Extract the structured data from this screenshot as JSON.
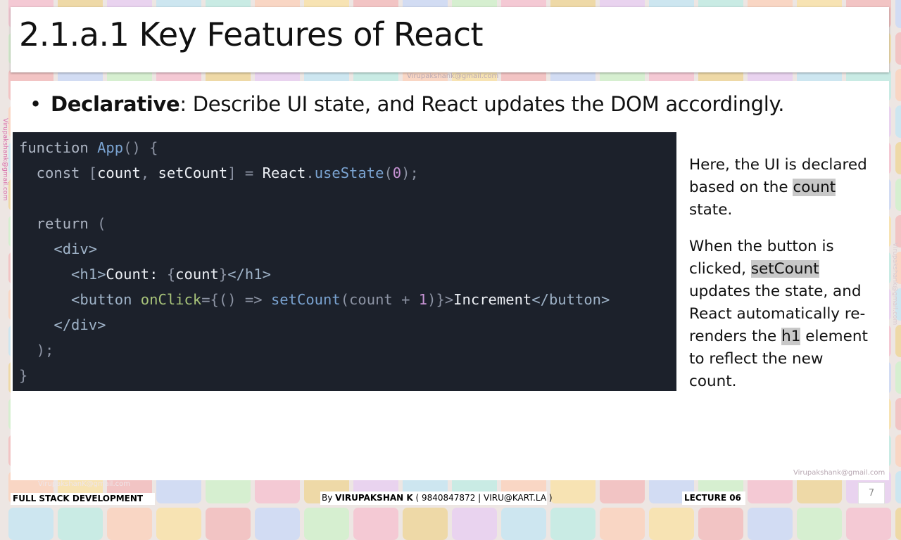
{
  "slide": {
    "title": "2.1.a.1 Key Features of React",
    "bullet_bold": "Declarative",
    "bullet_rest": ": Describe UI state, and React updates the DOM accordingly."
  },
  "code_lines": [
    [
      [
        "kw",
        "function "
      ],
      [
        "fn",
        "App"
      ],
      [
        "br",
        "() {"
      ]
    ],
    [
      [
        "kw",
        "  const "
      ],
      [
        "br",
        "["
      ],
      [
        "id",
        "count"
      ],
      [
        "br",
        ", "
      ],
      [
        "id",
        "setCount"
      ],
      [
        "br",
        "] = "
      ],
      [
        "id",
        "React"
      ],
      [
        "br",
        "."
      ],
      [
        "fn",
        "useState"
      ],
      [
        "br",
        "("
      ],
      [
        "num",
        "0"
      ],
      [
        "br",
        ");"
      ]
    ],
    [],
    [
      [
        "kw",
        "  return "
      ],
      [
        "br",
        "("
      ]
    ],
    [
      [
        "tg",
        "    <div>"
      ]
    ],
    [
      [
        "tg",
        "      <h1>"
      ],
      [
        "id",
        "Count: "
      ],
      [
        "br",
        "{"
      ],
      [
        "id",
        "count"
      ],
      [
        "br",
        "}"
      ],
      [
        "tg",
        "</h1>"
      ]
    ],
    [
      [
        "tg",
        "      <button "
      ],
      [
        "at",
        "onClick"
      ],
      [
        "br",
        "={() => "
      ],
      [
        "fn",
        "setCount"
      ],
      [
        "br",
        "(count + "
      ],
      [
        "num",
        "1"
      ],
      [
        "br",
        ")}>"
      ],
      [
        "id",
        "Increment"
      ],
      [
        "tg",
        "</button>"
      ]
    ],
    [
      [
        "tg",
        "    </div>"
      ]
    ],
    [
      [
        "br",
        "  );"
      ]
    ],
    [
      [
        "br",
        "}"
      ]
    ]
  ],
  "explanation": {
    "p1_before": "Here, the UI is declared based on the ",
    "p1_highlight": "count",
    "p1_after": " state.",
    "p2_before": "When the button is clicked, ",
    "p2_highlight1": "setCount",
    "p2_middle": " updates the state, and React automatically re-renders the ",
    "p2_highlight2": "h1",
    "p2_after": " element to reflect the new count."
  },
  "watermarks": {
    "email": "Virupakshank@gmail.com",
    "email_bottom_left": "VirupakshanK@gmail.com",
    "email_bottom_right": "Virupakshank@gmail.com",
    "email_vertical": "Virupakshank@gmail.com"
  },
  "footer": {
    "course": "FULL STACK DEVELOPMENT",
    "author_prefix": "By ",
    "author_name": "VIRUPAKSHAN K",
    "author_contact": " ( 9840847872 | VIRU@KART.LA )",
    "lecture": "LECTURE 06",
    "page_number": "7"
  },
  "colors": {
    "code_background": "#1c212b",
    "highlight": "#c8c8c8",
    "watermark_vertical": "#d86aa8"
  }
}
